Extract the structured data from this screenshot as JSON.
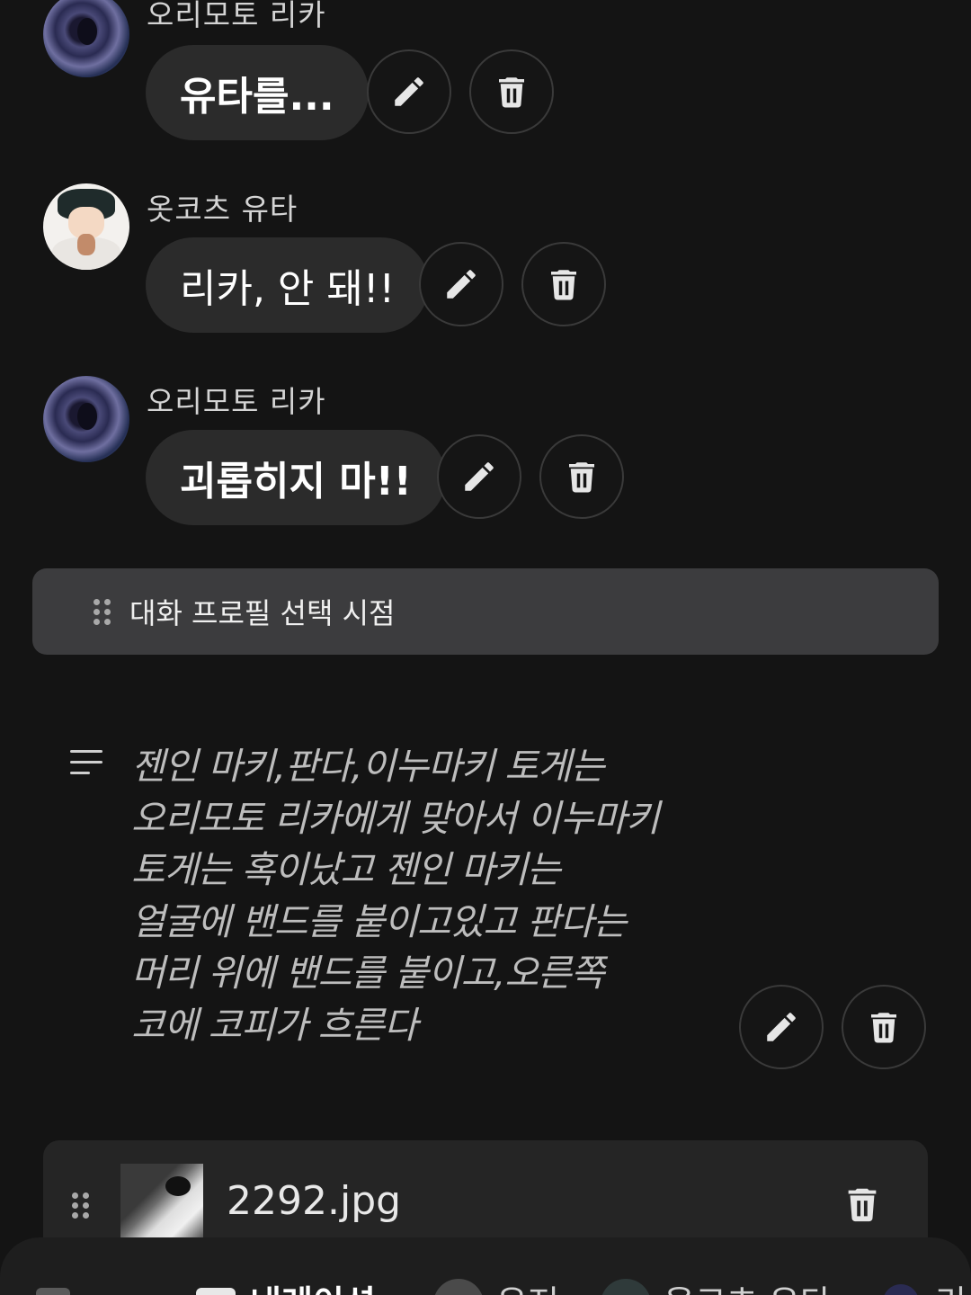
{
  "messages": [
    {
      "speaker": "오리모토 리카",
      "text": "유타를...",
      "bold": true
    },
    {
      "speaker": "옷코츠 유타",
      "text": "리카, 안 돼!!",
      "bold": false
    },
    {
      "speaker": "오리모토 리카",
      "text": "괴롭히지 마!!",
      "bold": true
    }
  ],
  "divider": {
    "label": "대화 프로필 선택 시점"
  },
  "narration": {
    "lines": [
      "젠인 마키,판다,이누마키 토게는",
      "오리모토 리카에게 맞아서 이누마키",
      "토게는 혹이났고 젠인 마키는",
      "얼굴에 밴드를 붙이고있고 판다는",
      "머리 위에 밴드를 붙이고,오른쪽",
      "코에 코피가 흐른다"
    ]
  },
  "attachment": {
    "filename": "2292.jpg"
  },
  "bottom_tabs": {
    "tab1": "",
    "tab2": "내레이션",
    "tab3": "유저",
    "tab4": "옷코츠 유타",
    "tab5": "리"
  },
  "icons": {
    "edit": "pencil-icon",
    "delete": "trash-icon",
    "drag": "drag-handle-icon",
    "narration": "text-lines-icon"
  },
  "colors": {
    "background": "#141414",
    "bubble": "#2b2b2b",
    "divider": "#3c3c3e",
    "narration_text": "#bdbdbd"
  }
}
